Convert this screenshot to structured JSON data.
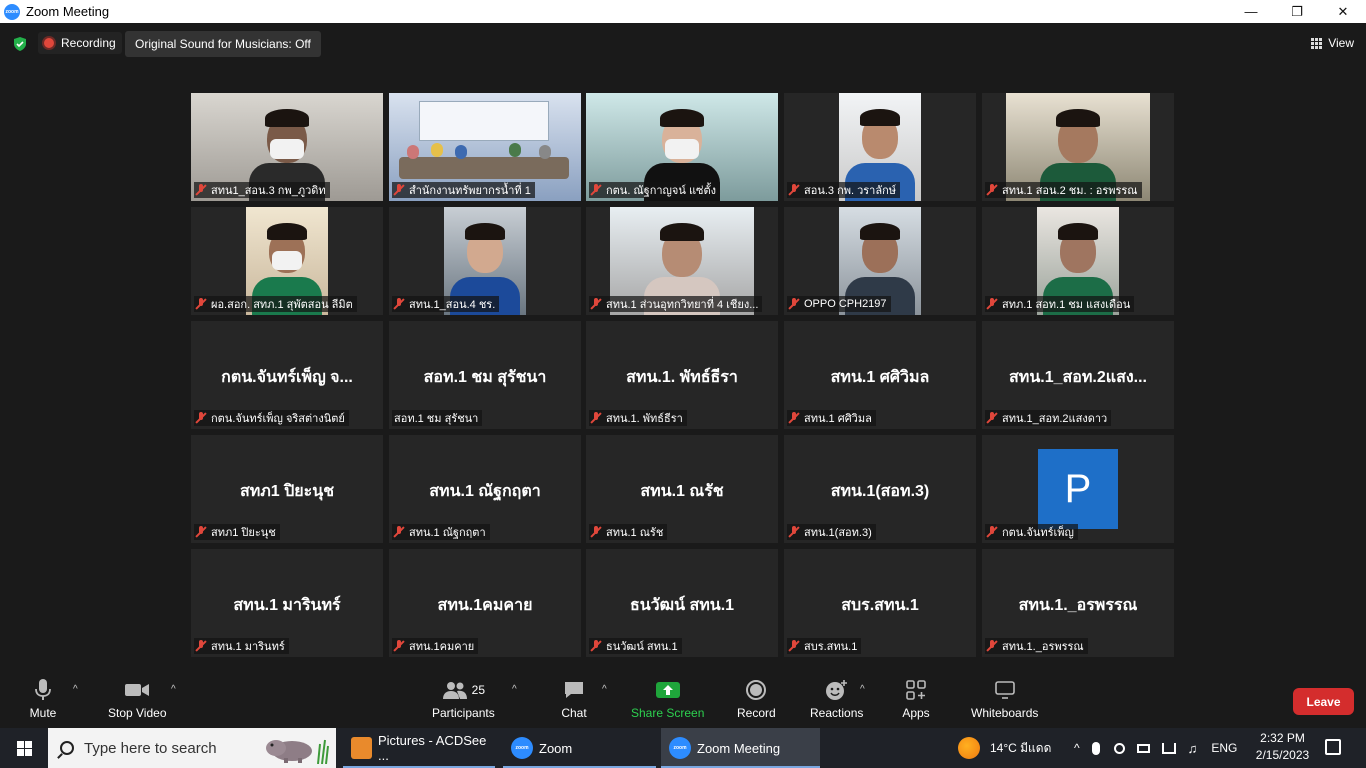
{
  "window": {
    "title": "Zoom Meeting",
    "logo_text": "zoom"
  },
  "topbar": {
    "recording_label": "Recording",
    "original_sound": "Original Sound for Musicians: Off",
    "view_label": "View"
  },
  "tiles": [
    {
      "label": "สทน1_สอน.3 กพ_ภูวดิท",
      "video": true
    },
    {
      "label": "สำนักงานทรัพยากรน้ำที่ 1",
      "video": true
    },
    {
      "label": "กตน. ณัฐกาญจน์ แซ่ตั้ง",
      "video": true,
      "active": true
    },
    {
      "label": "สอน.3 กพ. วราลักษ์",
      "video": true
    },
    {
      "label": "สทน.1 สอน.2 ชม. : อรพรรณ",
      "video": true
    },
    {
      "label": "ผอ.สอก. สทภ.1 สุพัตสอน ลีมิต",
      "video": true
    },
    {
      "label": "สทน.1_สอน.4 ชร.",
      "video": true
    },
    {
      "label": "สทน.1 ส่วนอุทกวิทยาที่ 4 เชียง...",
      "video": true
    },
    {
      "label": "OPPO CPH2197",
      "video": true
    },
    {
      "label": "สทภ.1 สอท.1 ชม แสงเดือน",
      "video": true
    },
    {
      "name": "กตน.จันทร์เพ็ญ จ...",
      "label": "กตน.จันทร์เพ็ญ จริสต่างนิตย์"
    },
    {
      "name": "สอท.1 ชม สุรัชนา",
      "label": "สอท.1 ชม สุรัชนา",
      "unmuted": true
    },
    {
      "name": "สทน.1. พัทธ์ธีรา",
      "label": "สทน.1. พัทธ์ธีรา"
    },
    {
      "name": "สทน.1 ศศิวิมล",
      "label": "สทน.1 ศศิวิมล"
    },
    {
      "name": "สทน.1_สอท.2แสง...",
      "label": "สทน.1_สอท.2แสงดาว"
    },
    {
      "name": "สทภ1 ปิยะนุช",
      "label": "สทภ1 ปิยะนุช"
    },
    {
      "name": "สทน.1 ณัฐกฤตา",
      "label": "สทน.1 ณัฐกฤตา"
    },
    {
      "name": "สทน.1 ณรัช",
      "label": "สทน.1 ณรัช"
    },
    {
      "name": "สทน.1(สอท.3)",
      "label": "สทน.1(สอท.3)"
    },
    {
      "avatar": "P",
      "label": "กตน.จันทร์เพ็ญ"
    },
    {
      "name": "สทน.1 มารินทร์",
      "label": "สทน.1 มารินทร์"
    },
    {
      "name": "สทน.1คมคาย",
      "label": "สทน.1คมคาย"
    },
    {
      "name": "ธนวัฒน์ สทน.1",
      "label": "ธนวัฒน์ สทน.1"
    },
    {
      "name": "สบร.สทน.1",
      "label": "สบร.สทน.1"
    },
    {
      "name": "สทน.1._อรพรรณ",
      "label": "สทน.1._อรพรรณ"
    }
  ],
  "toolbar": {
    "mute": "Mute",
    "stop_video": "Stop Video",
    "participants": "Participants",
    "participants_count": "25",
    "chat": "Chat",
    "share_screen": "Share Screen",
    "record": "Record",
    "reactions": "Reactions",
    "apps": "Apps",
    "whiteboards": "Whiteboards",
    "leave": "Leave"
  },
  "taskbar": {
    "search_placeholder": "Type here to search",
    "apps": [
      "Pictures - ACDSee ...",
      "Zoom",
      "Zoom Meeting"
    ],
    "weather": "14°C มีแดด",
    "language": "ENG",
    "time": "2:32 PM",
    "date": "2/15/2023"
  },
  "colors": {
    "accent": "#2d8cff",
    "share_green": "#1fa53b",
    "leave_red": "#d42d2d",
    "active_speaker": "#c7d94a",
    "muted_red": "#e0473b"
  }
}
